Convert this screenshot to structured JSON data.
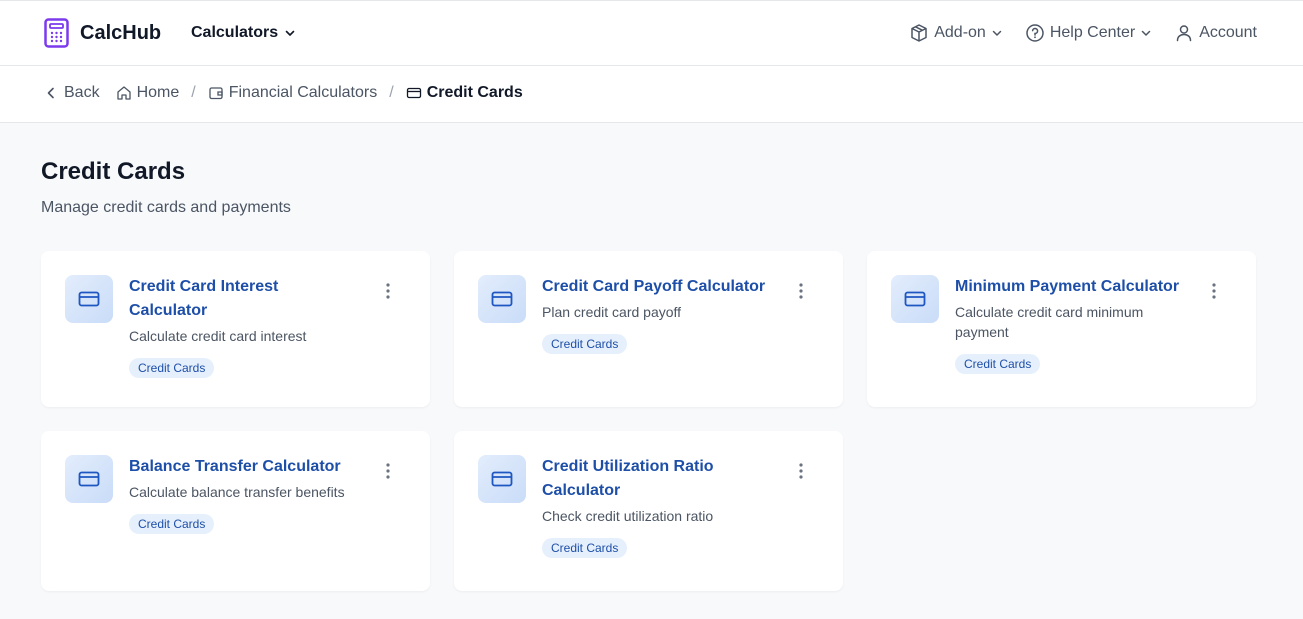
{
  "brand": {
    "name": "CalcHub",
    "accent": "#7c3aed"
  },
  "nav": {
    "calculators_label": "Calculators"
  },
  "top_right": {
    "addon_label": "Add-on",
    "help_label": "Help Center",
    "account_label": "Account"
  },
  "breadcrumb": {
    "back_label": "Back",
    "home_label": "Home",
    "financial_label": "Financial Calculators",
    "current_label": "Credit Cards",
    "separator": "/"
  },
  "page": {
    "title": "Credit Cards",
    "subtitle": "Manage credit cards and payments"
  },
  "cards": [
    {
      "title": "Credit Card Interest Calculator",
      "description": "Calculate credit card interest",
      "tag": "Credit Cards"
    },
    {
      "title": "Credit Card Payoff Calculator",
      "description": "Plan credit card payoff",
      "tag": "Credit Cards"
    },
    {
      "title": "Minimum Payment Calculator",
      "description": "Calculate credit card minimum payment",
      "tag": "Credit Cards"
    },
    {
      "title": "Balance Transfer Calculator",
      "description": "Calculate balance transfer benefits",
      "tag": "Credit Cards"
    },
    {
      "title": "Credit Utilization Ratio Calculator",
      "description": "Check credit utilization ratio",
      "tag": "Credit Cards"
    }
  ],
  "colors": {
    "link_blue": "#1e4fa8",
    "tag_bg": "#e6f0fc",
    "page_bg": "#f8f9fb"
  }
}
